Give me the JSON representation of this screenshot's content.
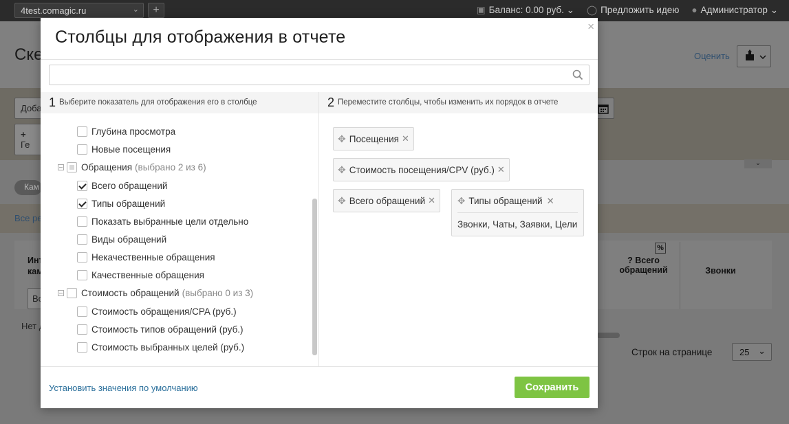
{
  "topbar": {
    "site": "4test.comagic.ru",
    "balance": "Баланс: 0.00 руб.",
    "suggest": "Предложить идею",
    "user": "Администратор"
  },
  "background": {
    "page_title": "Ске",
    "rate_link": "Оценить",
    "add_button": "Доба",
    "group_button": "Ге",
    "chip": "Кам",
    "all_link": "Все ре",
    "col_int": "Инт",
    "col_kam": "кам",
    "col_vs": "Вс",
    "col_pct": "%",
    "col_total": "Всего обращений",
    "col_calls": "Звонки",
    "no_data": "Нет д",
    "rows_per_page_label": "Строк на странице",
    "rows_per_page_value": "25"
  },
  "modal": {
    "title": "Столбцы для отображения в отчете",
    "search_placeholder": "",
    "left": {
      "number": "1",
      "header": "Выберите показатель для отображения его в столбце",
      "items": [
        {
          "label": "Глубина просмотра",
          "checked": false
        },
        {
          "label": "Новые посещения",
          "checked": false
        },
        {
          "label": "Обращения",
          "note": "(выбрано 2 из 6)",
          "group": true
        },
        {
          "label": "Всего обращений",
          "checked": true
        },
        {
          "label": "Типы обращений",
          "checked": true
        },
        {
          "label": "Показать выбранные цели отдельно",
          "checked": false
        },
        {
          "label": "Виды обращений",
          "checked": false
        },
        {
          "label": "Некачественные обращения",
          "checked": false
        },
        {
          "label": "Качественные обращения",
          "checked": false
        },
        {
          "label": "Стоимость обращений",
          "note": "(выбрано 0 из 3)",
          "group": true
        },
        {
          "label": "Стоимость обращения/CPA (руб.)",
          "checked": false
        },
        {
          "label": "Стоимость типов обращений (руб.)",
          "checked": false
        },
        {
          "label": "Стоимость выбранных целей (руб.)",
          "checked": false
        }
      ]
    },
    "right": {
      "number": "2",
      "header": "Переместите столбцы, чтобы изменить их порядок в отчете",
      "columns": [
        {
          "label": "Посещения"
        },
        {
          "label": "Стоимость посещения/CPV (руб.)"
        },
        {
          "label": "Всего обращений"
        },
        {
          "label": "Типы обращений",
          "sub": "Звонки, Чаты, Заявки, Цели"
        }
      ]
    },
    "reset_link": "Установить значения по умолчанию",
    "save_label": "Сохранить",
    "close_symbol": "×"
  }
}
